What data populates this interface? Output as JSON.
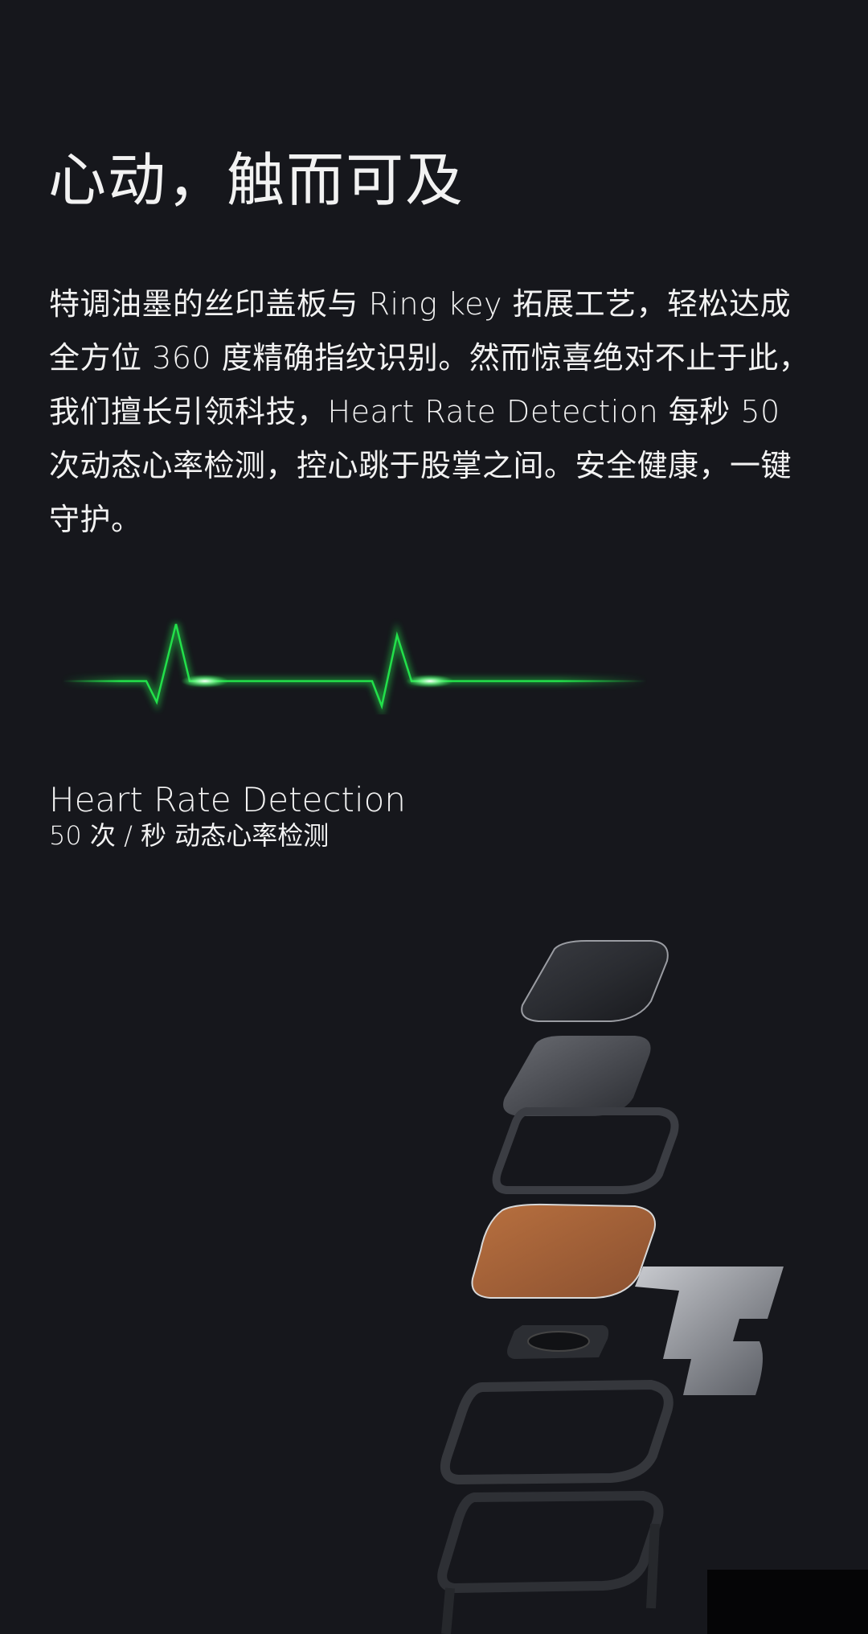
{
  "section": {
    "title": "心动，触而可及",
    "paragraph": "特调油墨的丝印盖板与 Ring key 拓展工艺，轻松达成全方位 360 度精确指纹识别。然而惊喜绝对不止于此，我们擅长引领科技，Heart Rate Detection 每秒 50 次动态心率检测，控心跳于股掌之间。安全健康，一键守护。"
  },
  "heart_rate": {
    "title": "Heart Rate Detection",
    "subtitle": "50 次 / 秒 动态心率检测",
    "line_color": "#22e04a"
  },
  "colors": {
    "background": "#16171c",
    "text": "#f2f2f2",
    "copper": "#a8643a"
  }
}
